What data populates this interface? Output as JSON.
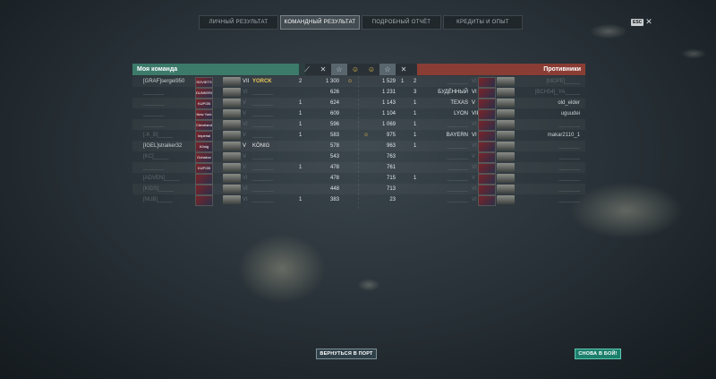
{
  "tabs": [
    "ЛИЧНЫЙ РЕЗУЛЬТАТ",
    "КОМАНДНЫЙ РЕЗУЛЬТАТ",
    "ПОДРОБНЫЙ ОТЧЁТ",
    "КРЕДИТЫ И ОПЫТ"
  ],
  "esc_label": "ESC",
  "close_glyph": "✕",
  "my_team_label": "Моя команда",
  "enemy_team_label": "Противники",
  "left_rows": [
    {
      "player": "[GRAF]sergei950",
      "flag": "SOVIETS",
      "tier": "VII",
      "ship": "YORCK",
      "kills": "2",
      "score": "1 300",
      "smile": "☺",
      "dim": false,
      "gold": true
    },
    {
      "player": "_______",
      "flag": "DUNKERQUE",
      "tier": "VI",
      "ship": "_______",
      "kills": "",
      "score": "626",
      "smile": "",
      "dim": true,
      "gold": false
    },
    {
      "player": "_______",
      "flag": "KUPOB",
      "tier": "V",
      "ship": "_______",
      "kills": "1",
      "score": "624",
      "smile": "",
      "dim": true,
      "gold": false
    },
    {
      "player": "_______",
      "flag": "New York",
      "tier": "V",
      "ship": "_______",
      "kills": "1",
      "score": "609",
      "smile": "",
      "dim": true,
      "gold": false
    },
    {
      "player": "_______",
      "flag": "Cleveland",
      "tier": "VI",
      "ship": "_______",
      "kills": "1",
      "score": "596",
      "smile": "",
      "dim": true,
      "gold": false
    },
    {
      "player": "[-K_B]_____",
      "flag": "Imperial",
      "tier": "V",
      "ship": "_______",
      "kills": "1",
      "score": "583",
      "smile": "",
      "dim": true,
      "gold": false
    },
    {
      "player": "[IGEL]straiker32",
      "flag": "König",
      "tier": "V",
      "ship": "KÖNIG",
      "kills": "",
      "score": "578",
      "smile": "",
      "dim": false,
      "gold": false
    },
    {
      "player": "[KC]_____",
      "flag": "Ochakov",
      "tier": "V",
      "ship": "_______",
      "kills": "",
      "score": "543",
      "smile": "",
      "dim": true,
      "gold": false
    },
    {
      "player": "_______",
      "flag": "KUPOB",
      "tier": "V",
      "ship": "_______",
      "kills": "1",
      "score": "478",
      "smile": "",
      "dim": true,
      "gold": false
    },
    {
      "player": "[ADVEN]_____",
      "flag": "",
      "tier": "VI",
      "ship": "_______",
      "kills": "",
      "score": "478",
      "smile": "",
      "dim": true,
      "gold": false
    },
    {
      "player": "[KIDS]_____",
      "flag": "",
      "tier": "VI",
      "ship": "_______",
      "kills": "",
      "score": "448",
      "smile": "",
      "dim": true,
      "gold": false
    },
    {
      "player": "[NUB]_____",
      "flag": "",
      "tier": "VI",
      "ship": "_______",
      "kills": "1",
      "score": "383",
      "smile": "",
      "dim": true,
      "gold": false
    }
  ],
  "right_rows": [
    {
      "score": "1 529",
      "kills": "1",
      "cap": "2",
      "ship": "_______",
      "tier": "VI",
      "player": "[MOPE]_____",
      "smile": "",
      "dim_ship": true,
      "dim_player": true
    },
    {
      "score": "1 231",
      "kills": "",
      "cap": "3",
      "ship": "БУДЁННЫЙ",
      "tier": "VI",
      "player": "[BCH54]_YA_____",
      "smile": "",
      "dim_ship": false,
      "dim_player": true
    },
    {
      "score": "1 143",
      "kills": "",
      "cap": "1",
      "ship": "TEXAS",
      "tier": "V",
      "player": "old_elder",
      "smile": "",
      "dim_ship": false,
      "dim_player": false
    },
    {
      "score": "1 104",
      "kills": "",
      "cap": "1",
      "ship": "LYON",
      "tier": "VII",
      "player": "uguudei",
      "smile": "",
      "dim_ship": false,
      "dim_player": false
    },
    {
      "score": "1 069",
      "kills": "",
      "cap": "1",
      "ship": "_______",
      "tier": "VI",
      "player": "_______",
      "smile": "",
      "dim_ship": true,
      "dim_player": true
    },
    {
      "score": "975",
      "kills": "",
      "cap": "1",
      "ship": "BAYERN",
      "tier": "VI",
      "player": "makar2110_1",
      "smile": "☺",
      "dim_ship": false,
      "dim_player": false
    },
    {
      "score": "963",
      "kills": "",
      "cap": "1",
      "ship": "_______",
      "tier": "VI",
      "player": "_______",
      "smile": "",
      "dim_ship": true,
      "dim_player": true
    },
    {
      "score": "763",
      "kills": "",
      "cap": "",
      "ship": "_______",
      "tier": "V",
      "player": "_______",
      "smile": "",
      "dim_ship": true,
      "dim_player": true
    },
    {
      "score": "761",
      "kills": "",
      "cap": "",
      "ship": "_______",
      "tier": "VI",
      "player": "_______",
      "smile": "",
      "dim_ship": true,
      "dim_player": true
    },
    {
      "score": "715",
      "kills": "",
      "cap": "1",
      "ship": "_______",
      "tier": "V",
      "player": "_______",
      "smile": "",
      "dim_ship": true,
      "dim_player": true
    },
    {
      "score": "713",
      "kills": "",
      "cap": "",
      "ship": "_______",
      "tier": "VI",
      "player": "_______",
      "smile": "",
      "dim_ship": true,
      "dim_player": true
    },
    {
      "score": "23",
      "kills": "",
      "cap": "",
      "ship": "_______",
      "tier": "VI",
      "player": "_______",
      "smile": "",
      "dim_ship": true,
      "dim_player": true
    }
  ],
  "buttons": {
    "port": "ВЕРНУТЬСЯ В ПОРТ",
    "fight": "СНОВА В БОЙ!"
  },
  "colors": {
    "my_team_header": "#3c7a6a",
    "enemy_header": "#8a3d34",
    "fight_button": "#1b7f6c",
    "highlight_name": "#e6c55a"
  }
}
